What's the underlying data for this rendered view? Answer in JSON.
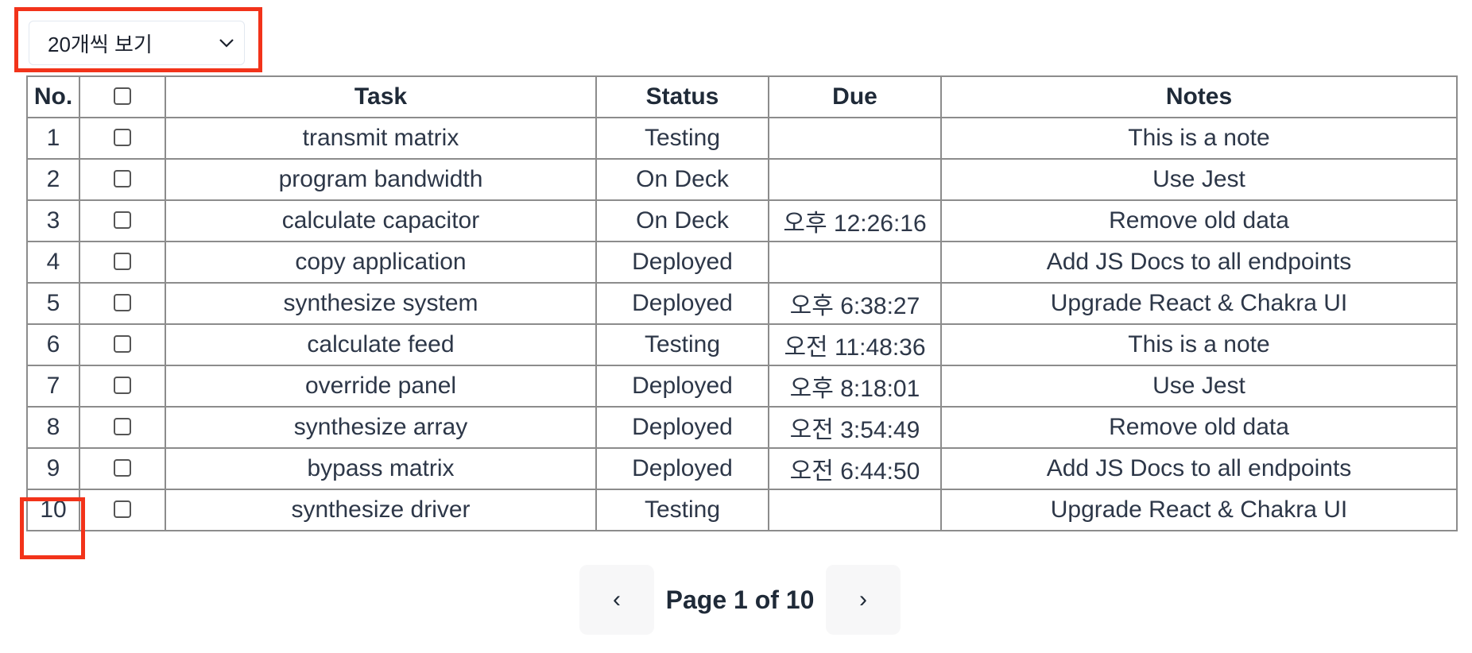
{
  "page_size": {
    "selected": "20개씩 보기"
  },
  "table": {
    "headers": [
      "No.",
      "",
      "Task",
      "Status",
      "Due",
      "Notes"
    ],
    "rows": [
      {
        "no": "1",
        "task": "transmit matrix",
        "status": "Testing",
        "due": "",
        "notes": "This is a note"
      },
      {
        "no": "2",
        "task": "program bandwidth",
        "status": "On Deck",
        "due": "",
        "notes": "Use Jest"
      },
      {
        "no": "3",
        "task": "calculate capacitor",
        "status": "On Deck",
        "due": "오후 12:26:16",
        "notes": "Remove old data"
      },
      {
        "no": "4",
        "task": "copy application",
        "status": "Deployed",
        "due": "",
        "notes": "Add JS Docs to all endpoints"
      },
      {
        "no": "5",
        "task": "synthesize system",
        "status": "Deployed",
        "due": "오후 6:38:27",
        "notes": "Upgrade React & Chakra UI"
      },
      {
        "no": "6",
        "task": "calculate feed",
        "status": "Testing",
        "due": "오전 11:48:36",
        "notes": "This is a note"
      },
      {
        "no": "7",
        "task": "override panel",
        "status": "Deployed",
        "due": "오후 8:18:01",
        "notes": "Use Jest"
      },
      {
        "no": "8",
        "task": "synthesize array",
        "status": "Deployed",
        "due": "오전 3:54:49",
        "notes": "Remove old data"
      },
      {
        "no": "9",
        "task": "bypass matrix",
        "status": "Deployed",
        "due": "오전 6:44:50",
        "notes": "Add JS Docs to all endpoints"
      },
      {
        "no": "10",
        "task": "synthesize driver",
        "status": "Testing",
        "due": "",
        "notes": "Upgrade React & Chakra UI"
      }
    ]
  },
  "pagination": {
    "prev": "‹",
    "label": "Page 1 of 10",
    "next": "›"
  },
  "colors": {
    "highlight": "#f2331a",
    "border": "#8c8c8c"
  }
}
